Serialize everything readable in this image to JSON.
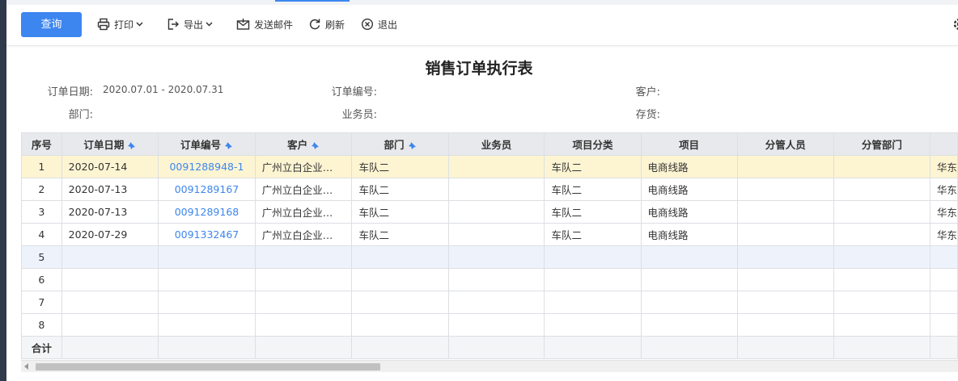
{
  "toolbar": {
    "query_label": "查询",
    "print_label": "打印",
    "export_label": "导出",
    "email_label": "发送邮件",
    "refresh_label": "刷新",
    "exit_label": "退出"
  },
  "report": {
    "title": "销售订单执行表",
    "filters": {
      "order_date_label": "订单日期:",
      "order_date_value": "2020.07.01 - 2020.07.31",
      "order_no_label": "订单编号:",
      "customer_label": "客户:",
      "dept_label": "部门:",
      "salesman_label": "业务员:",
      "inventory_label": "存货:"
    }
  },
  "table": {
    "columns": [
      "序号",
      "订单日期",
      "订单编号",
      "客户",
      "部门",
      "业务员",
      "项目分类",
      "项目",
      "分管人员",
      "分管部门",
      ""
    ],
    "rows": [
      {
        "idx": "1",
        "date": "2020-07-14",
        "order_no": "0091288948-1",
        "customer": "广州立白企业…",
        "dept": "车队二",
        "salesman": "",
        "proj_cat": "车队二",
        "project": "电商线路",
        "manager": "",
        "mgr_dept": "",
        "extra": "华东"
      },
      {
        "idx": "2",
        "date": "2020-07-13",
        "order_no": "0091289167",
        "customer": "广州立白企业…",
        "dept": "车队二",
        "salesman": "",
        "proj_cat": "车队二",
        "project": "电商线路",
        "manager": "",
        "mgr_dept": "",
        "extra": "华东"
      },
      {
        "idx": "3",
        "date": "2020-07-13",
        "order_no": "0091289168",
        "customer": "广州立白企业…",
        "dept": "车队二",
        "salesman": "",
        "proj_cat": "车队二",
        "project": "电商线路",
        "manager": "",
        "mgr_dept": "",
        "extra": "华东"
      },
      {
        "idx": "4",
        "date": "2020-07-29",
        "order_no": "0091332467",
        "customer": "广州立白企业…",
        "dept": "车队二",
        "salesman": "",
        "proj_cat": "车队二",
        "project": "电商线路",
        "manager": "",
        "mgr_dept": "",
        "extra": "华东"
      }
    ],
    "empty_rows": [
      "5",
      "6",
      "7",
      "8"
    ],
    "total_label": "合计"
  }
}
